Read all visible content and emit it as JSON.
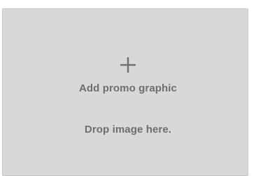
{
  "promo": {
    "icon": "plus-icon",
    "title": "Add promo graphic",
    "hint": "Drop image here."
  },
  "colors": {
    "background": "#d8d8d8",
    "text": "#6e6e6e"
  }
}
